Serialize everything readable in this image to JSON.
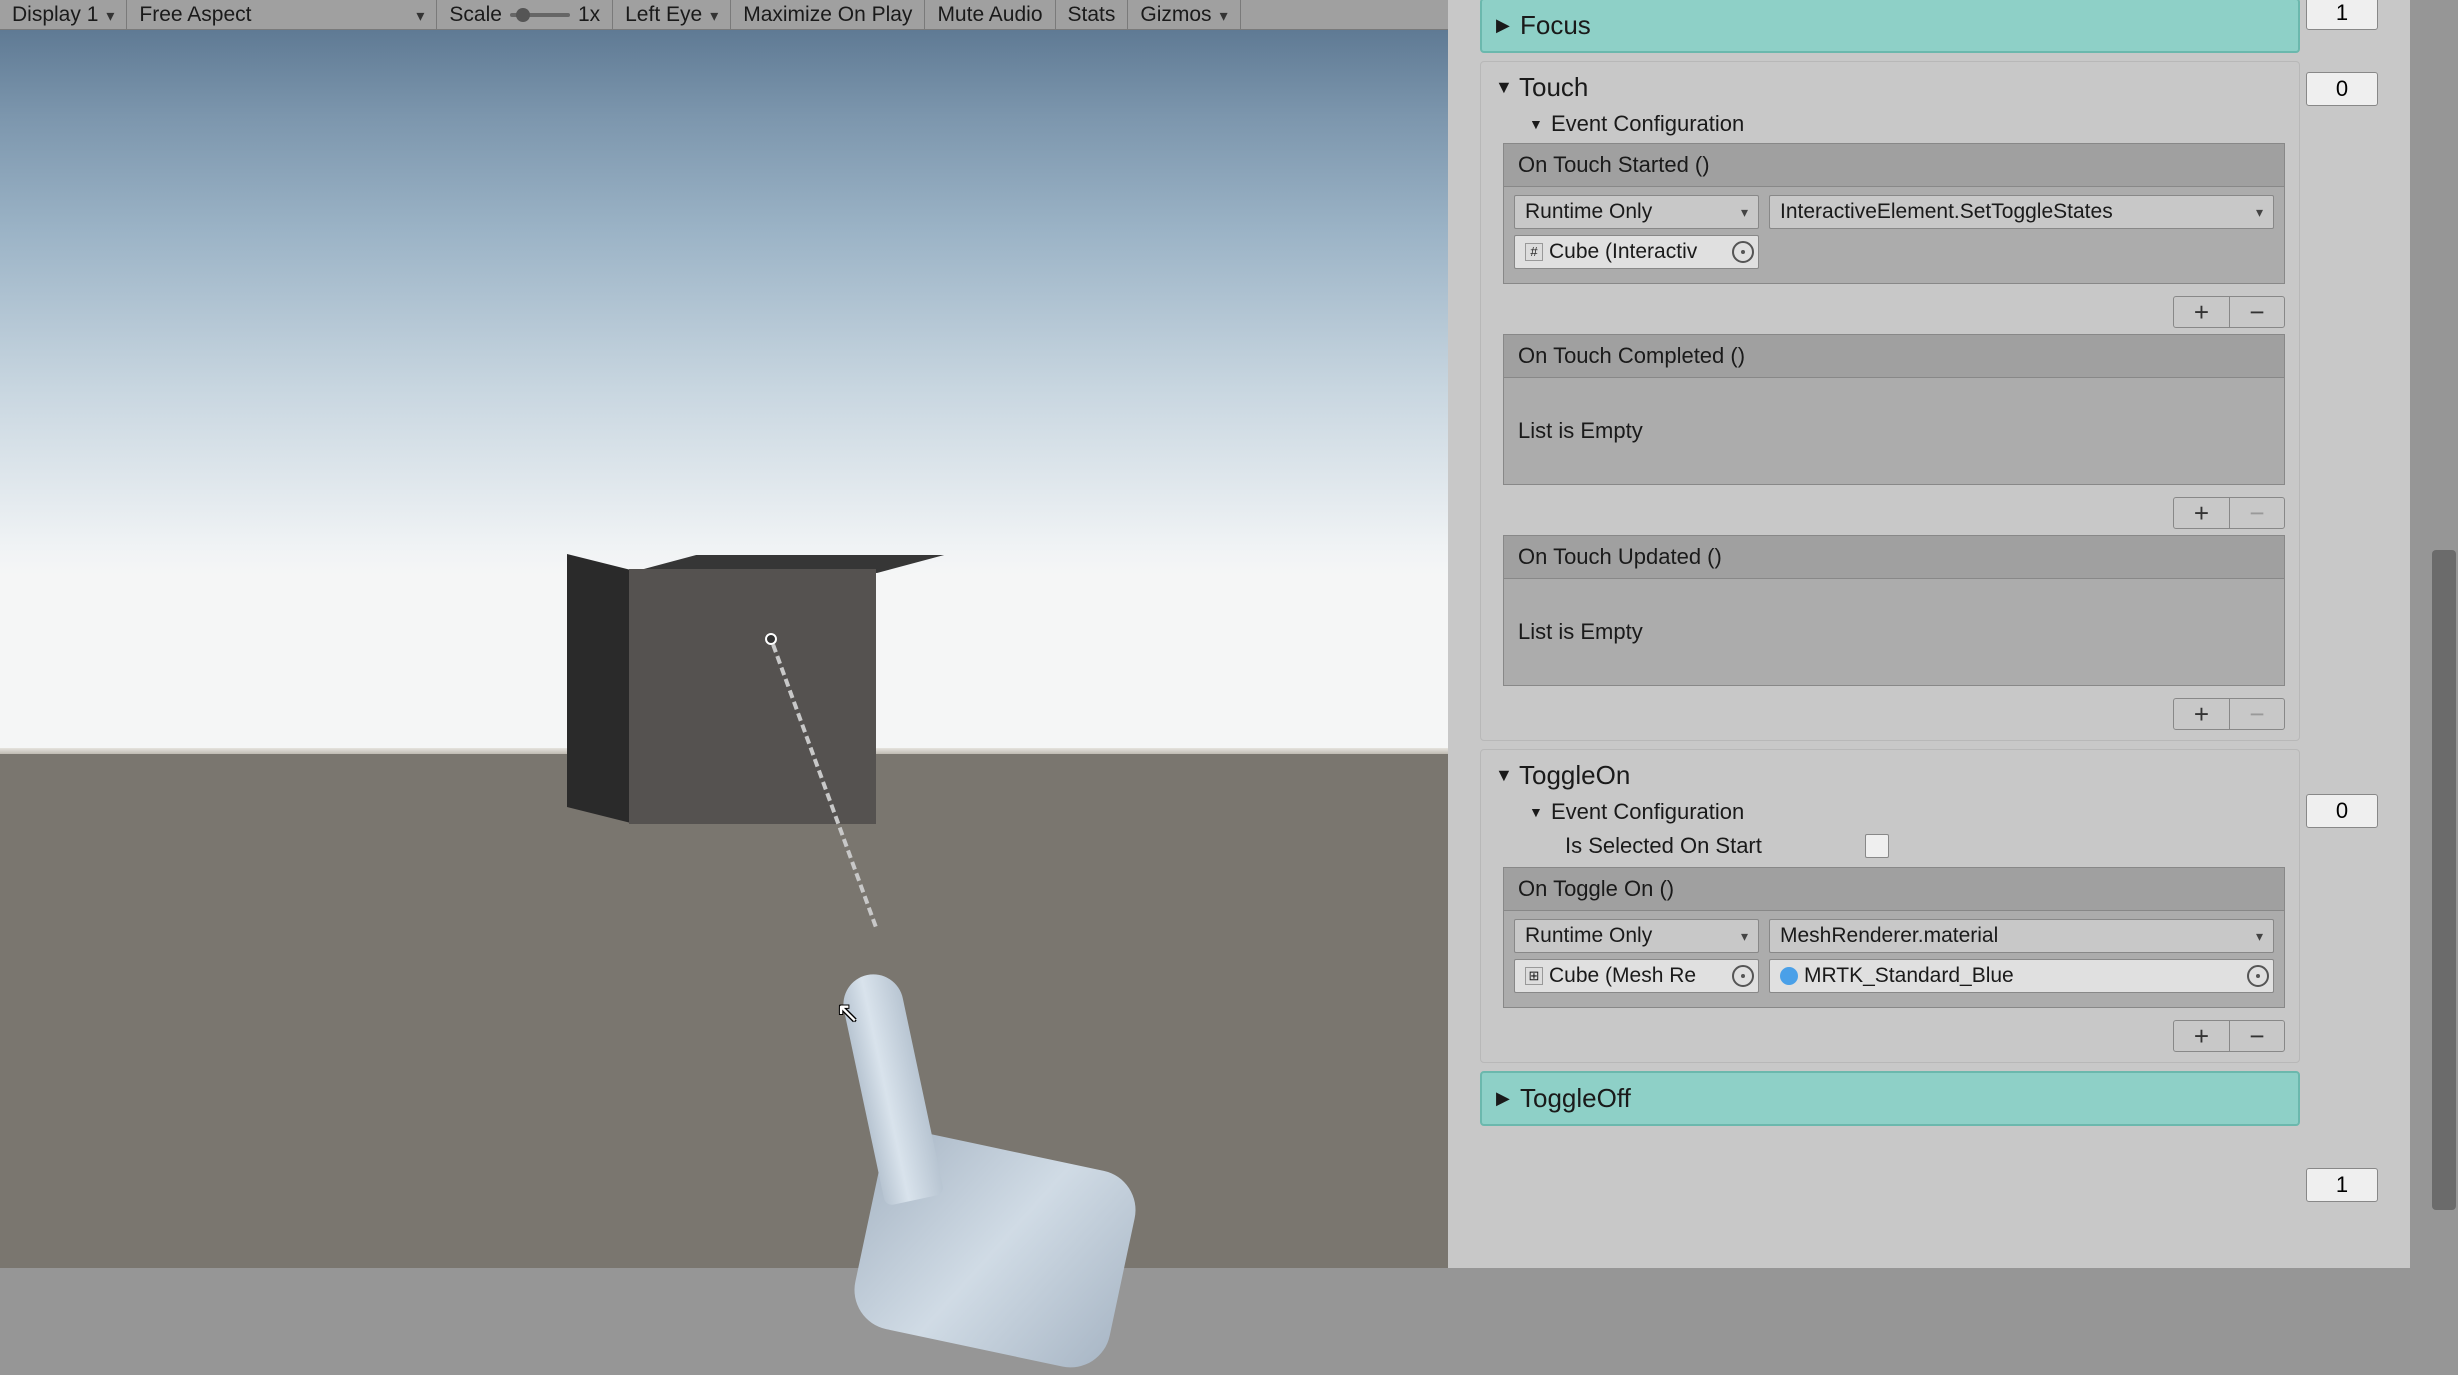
{
  "toolbar": {
    "display": "Display 1",
    "aspect": "Free Aspect",
    "scale_label": "Scale",
    "scale_value": "1x",
    "eye": "Left Eye",
    "maximize": "Maximize On Play",
    "mute": "Mute Audio",
    "stats": "Stats",
    "gizmos": "Gizmos"
  },
  "sections": {
    "focus": {
      "label": "Focus",
      "count": "1"
    },
    "touch": {
      "label": "Touch",
      "count": "0",
      "event_config": "Event Configuration",
      "on_touch_started": {
        "header": "On Touch Started ()",
        "runtime_mode": "Runtime Only",
        "function": "InteractiveElement.SetToggleStates",
        "object_ref": "Cube (Interactiv"
      },
      "on_touch_completed": {
        "header": "On Touch Completed ()",
        "empty": "List is Empty"
      },
      "on_touch_updated": {
        "header": "On Touch Updated ()",
        "empty": "List is Empty"
      }
    },
    "toggle_on": {
      "label": "ToggleOn",
      "count": "0",
      "event_config": "Event Configuration",
      "is_selected_label": "Is Selected On Start",
      "on_toggle_on": {
        "header": "On Toggle On ()",
        "runtime_mode": "Runtime Only",
        "function": "MeshRenderer.material",
        "object_ref": "Cube (Mesh Re",
        "material_ref": "MRTK_Standard_Blue"
      }
    },
    "toggle_off": {
      "label": "ToggleOff",
      "count": "1"
    }
  },
  "icons": {
    "plus": "+",
    "minus": "−",
    "hash": "#",
    "mesh": "⊞",
    "mat": "●"
  }
}
